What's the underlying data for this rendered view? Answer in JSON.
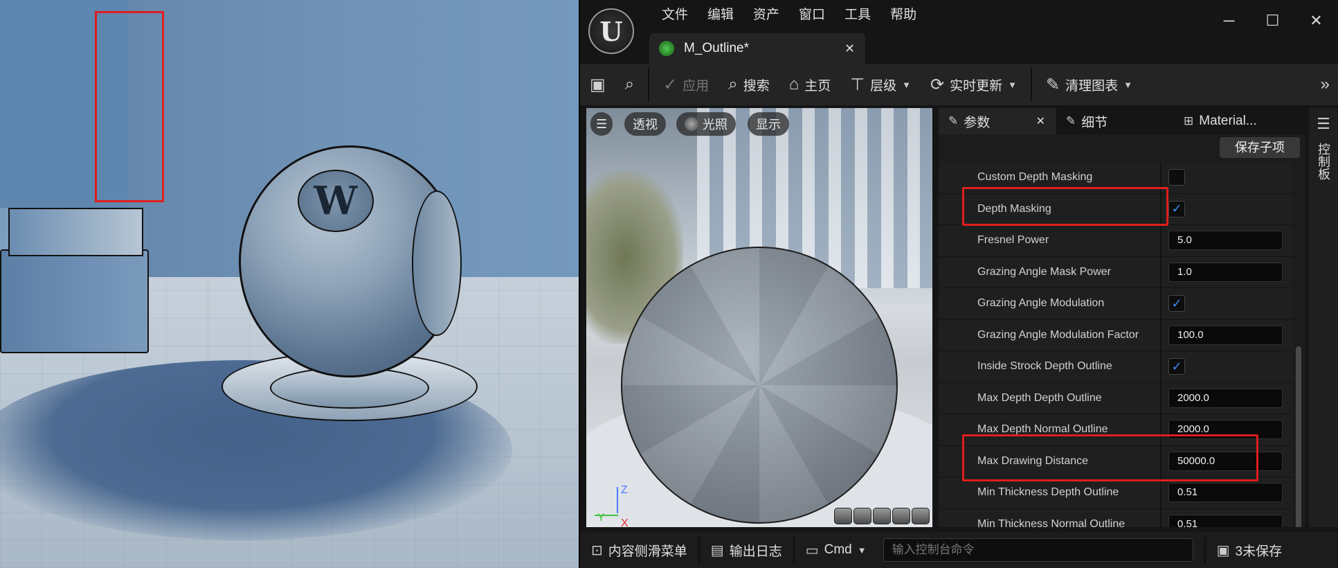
{
  "scene": {
    "emblem_glyph": "W"
  },
  "editor": {
    "logo_glyph": "U",
    "menu": [
      "文件",
      "编辑",
      "资产",
      "窗口",
      "工具",
      "帮助"
    ],
    "window_controls": {
      "minimize": "─",
      "maximize": "☐",
      "close": "✕"
    },
    "tab": {
      "title": "M_Outline*",
      "close": "✕"
    },
    "toolbar": {
      "save_icon": "save-icon",
      "browse_icon": "browse-icon",
      "apply": "应用",
      "search": "搜索",
      "home": "主页",
      "hierarchy": "层级",
      "live_update": "实时更新",
      "clean_graph": "清理图表",
      "more": "»"
    },
    "viewport": {
      "menu_icon": "☰",
      "perspective": "透视",
      "lighting": "光照",
      "show": "显示",
      "axis_z": "Z",
      "axis_y": "Y",
      "axis_x": "X"
    },
    "panel_tabs": {
      "params": "参数",
      "params_close": "✕",
      "details": "细节",
      "material": "Material..."
    },
    "side_strip_label": "控制板",
    "save_child": "保存子项",
    "parameters": [
      {
        "label": "Custom Depth Masking",
        "type": "checkbox",
        "checked": false
      },
      {
        "label": "Depth Masking",
        "type": "checkbox",
        "checked": true
      },
      {
        "label": "Fresnel Power",
        "type": "number",
        "value": "5.0"
      },
      {
        "label": "Grazing Angle Mask Power",
        "type": "number",
        "value": "1.0"
      },
      {
        "label": "Grazing Angle Modulation",
        "type": "checkbox",
        "checked": true
      },
      {
        "label": "Grazing Angle Modulation Factor",
        "type": "number",
        "value": "100.0"
      },
      {
        "label": "Inside Strock Depth Outline",
        "type": "checkbox",
        "checked": true
      },
      {
        "label": "Max Depth Depth Outline",
        "type": "number",
        "value": "2000.0"
      },
      {
        "label": "Max Depth Normal Outline",
        "type": "number",
        "value": "2000.0"
      },
      {
        "label": "Max Drawing Distance",
        "type": "number",
        "value": "50000.0"
      },
      {
        "label": "Min Thickness Depth Outline",
        "type": "number",
        "value": "0.51"
      },
      {
        "label": "Min Thickness Normal Outline",
        "type": "number",
        "value": "0.51"
      }
    ],
    "statusbar": {
      "content_drawer": "内容侧滑菜单",
      "output_log": "输出日志",
      "cmd": "Cmd",
      "console_placeholder": "输入控制台命令",
      "unsaved": "3未保存"
    }
  },
  "colors": {
    "highlight": "#e01e1e",
    "checkbox": "#3a8bff"
  }
}
